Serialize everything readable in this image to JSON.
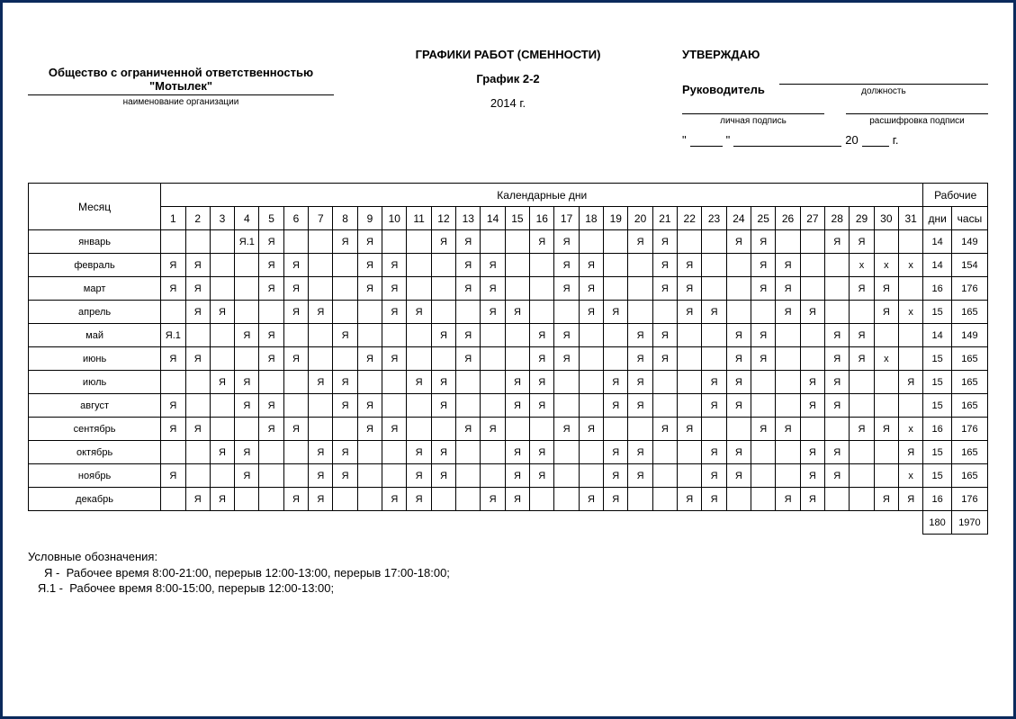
{
  "header": {
    "org_name": "Общество с ограниченной ответственностью \"Мотылек\"",
    "org_sub": "наименование организации",
    "title": "ГРАФИКИ РАБОТ (СМЕННОСТИ)",
    "schedule_name": "График 2-2",
    "year_line": "2014 г."
  },
  "approve": {
    "title": "УТВЕРЖДАЮ",
    "rukovoditel": "Руководитель",
    "position_label": "должность",
    "sign_label": "личная подпись",
    "decrypt_label": "расшифровка подписи",
    "quote_open": "\"",
    "quote_close": "\"",
    "twenty": "20",
    "year_suffix": "г."
  },
  "table_headers": {
    "month": "Месяц",
    "calendar_days": "Календарные дни",
    "work": "Рабочие",
    "days": "дни",
    "hours": "часы"
  },
  "day_numbers": [
    "1",
    "2",
    "3",
    "4",
    "5",
    "6",
    "7",
    "8",
    "9",
    "10",
    "11",
    "12",
    "13",
    "14",
    "15",
    "16",
    "17",
    "18",
    "19",
    "20",
    "21",
    "22",
    "23",
    "24",
    "25",
    "26",
    "27",
    "28",
    "29",
    "30",
    "31"
  ],
  "months": [
    {
      "name": "январь",
      "cells": [
        "",
        "",
        "",
        "Я.1",
        "Я",
        "",
        "",
        "Я",
        "Я",
        "",
        "",
        "Я",
        "Я",
        "",
        "",
        "Я",
        "Я",
        "",
        "",
        "Я",
        "Я",
        "",
        "",
        "Я",
        "Я",
        "",
        "",
        "Я",
        "Я",
        "",
        ""
      ],
      "dni": "14",
      "hrs": "149"
    },
    {
      "name": "февраль",
      "cells": [
        "Я",
        "Я",
        "",
        "",
        "Я",
        "Я",
        "",
        "",
        "Я",
        "Я",
        "",
        "",
        "Я",
        "Я",
        "",
        "",
        "Я",
        "Я",
        "",
        "",
        "Я",
        "Я",
        "",
        "",
        "Я",
        "Я",
        "",
        "",
        "x",
        "x",
        "x"
      ],
      "dni": "14",
      "hrs": "154"
    },
    {
      "name": "март",
      "cells": [
        "Я",
        "Я",
        "",
        "",
        "Я",
        "Я",
        "",
        "",
        "Я",
        "Я",
        "",
        "",
        "Я",
        "Я",
        "",
        "",
        "Я",
        "Я",
        "",
        "",
        "Я",
        "Я",
        "",
        "",
        "Я",
        "Я",
        "",
        "",
        "Я",
        "Я",
        ""
      ],
      "dni": "16",
      "hrs": "176"
    },
    {
      "name": "апрель",
      "cells": [
        "",
        "Я",
        "Я",
        "",
        "",
        "Я",
        "Я",
        "",
        "",
        "Я",
        "Я",
        "",
        "",
        "Я",
        "Я",
        "",
        "",
        "Я",
        "Я",
        "",
        "",
        "Я",
        "Я",
        "",
        "",
        "Я",
        "Я",
        "",
        "",
        "Я",
        "x"
      ],
      "dni": "15",
      "hrs": "165"
    },
    {
      "name": "май",
      "cells": [
        "Я.1",
        "",
        "",
        "Я",
        "Я",
        "",
        "",
        "Я",
        "",
        "",
        "",
        "Я",
        "Я",
        "",
        "",
        "Я",
        "Я",
        "",
        "",
        "Я",
        "Я",
        "",
        "",
        "Я",
        "Я",
        "",
        "",
        "Я",
        "Я",
        "",
        ""
      ],
      "dni": "14",
      "hrs": "149"
    },
    {
      "name": "июнь",
      "cells": [
        "Я",
        "Я",
        "",
        "",
        "Я",
        "Я",
        "",
        "",
        "Я",
        "Я",
        "",
        "",
        "Я",
        "",
        "",
        "Я",
        "Я",
        "",
        "",
        "Я",
        "Я",
        "",
        "",
        "Я",
        "Я",
        "",
        "",
        "Я",
        "Я",
        "x"
      ],
      "dni": "15",
      "hrs": "165"
    },
    {
      "name": "июль",
      "cells": [
        "",
        "",
        "Я",
        "Я",
        "",
        "",
        "Я",
        "Я",
        "",
        "",
        "Я",
        "Я",
        "",
        "",
        "Я",
        "Я",
        "",
        "",
        "Я",
        "Я",
        "",
        "",
        "Я",
        "Я",
        "",
        "",
        "Я",
        "Я",
        "",
        "",
        "Я"
      ],
      "dni": "15",
      "hrs": "165"
    },
    {
      "name": "август",
      "cells": [
        "Я",
        "",
        "",
        "Я",
        "Я",
        "",
        "",
        "Я",
        "Я",
        "",
        "",
        "Я",
        "",
        "",
        "Я",
        "Я",
        "",
        "",
        "Я",
        "Я",
        "",
        "",
        "Я",
        "Я",
        "",
        "",
        "Я",
        "Я",
        "",
        "",
        ""
      ],
      "dni": "15",
      "hrs": "165"
    },
    {
      "name": "сентябрь",
      "cells": [
        "Я",
        "Я",
        "",
        "",
        "Я",
        "Я",
        "",
        "",
        "Я",
        "Я",
        "",
        "",
        "Я",
        "Я",
        "",
        "",
        "Я",
        "Я",
        "",
        "",
        "Я",
        "Я",
        "",
        "",
        "Я",
        "Я",
        "",
        "",
        "Я",
        "Я",
        "x"
      ],
      "dni": "16",
      "hrs": "176"
    },
    {
      "name": "октябрь",
      "cells": [
        "",
        "",
        "Я",
        "Я",
        "",
        "",
        "Я",
        "Я",
        "",
        "",
        "Я",
        "Я",
        "",
        "",
        "Я",
        "Я",
        "",
        "",
        "Я",
        "Я",
        "",
        "",
        "Я",
        "Я",
        "",
        "",
        "Я",
        "Я",
        "",
        "",
        "Я"
      ],
      "dni": "15",
      "hrs": "165"
    },
    {
      "name": "ноябрь",
      "cells": [
        "Я",
        "",
        "",
        "Я",
        "",
        "",
        "Я",
        "Я",
        "",
        "",
        "Я",
        "Я",
        "",
        "",
        "Я",
        "Я",
        "",
        "",
        "Я",
        "Я",
        "",
        "",
        "Я",
        "Я",
        "",
        "",
        "Я",
        "Я",
        "",
        "",
        "x"
      ],
      "dni": "15",
      "hrs": "165"
    },
    {
      "name": "декабрь",
      "cells": [
        "",
        "Я",
        "Я",
        "",
        "",
        "Я",
        "Я",
        "",
        "",
        "Я",
        "Я",
        "",
        "",
        "Я",
        "Я",
        "",
        "",
        "Я",
        "Я",
        "",
        "",
        "Я",
        "Я",
        "",
        "",
        "Я",
        "Я",
        "",
        "",
        "Я",
        "Я"
      ],
      "dni": "16",
      "hrs": "176"
    }
  ],
  "totals": {
    "dni": "180",
    "hrs": "1970"
  },
  "legend": {
    "title": "Условные обозначения:",
    "lines": [
      "     Я -  Рабочее время 8:00-21:00, перерыв 12:00-13:00, перерыв 17:00-18:00;",
      "   Я.1 -  Рабочее время 8:00-15:00, перерыв 12:00-13:00;"
    ]
  }
}
